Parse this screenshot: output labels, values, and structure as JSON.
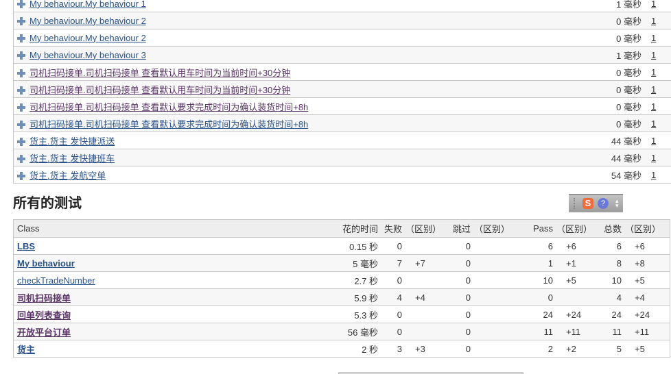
{
  "methods": [
    {
      "name": "My behaviour.My behaviour 1",
      "time": "1 毫秒",
      "count": "1",
      "visited": false
    },
    {
      "name": "My behaviour.My behaviour 2",
      "time": "0 毫秒",
      "count": "1",
      "visited": false
    },
    {
      "name": "My behaviour.My behaviour 2",
      "time": "0 毫秒",
      "count": "1",
      "visited": false
    },
    {
      "name": "My behaviour.My behaviour 3",
      "time": "1 毫秒",
      "count": "1",
      "visited": false
    },
    {
      "name": "司机扫码接单.司机扫码接单 查看默认用车时间为当前时间+30分钟",
      "time": "0 毫秒",
      "count": "1",
      "visited": true
    },
    {
      "name": "司机扫码接单.司机扫码接单 查看默认用车时间为当前时间+30分钟",
      "time": "0 毫秒",
      "count": "1",
      "visited": true
    },
    {
      "name": "司机扫码接单.司机扫码接单 查看默认要求完成时间为确认装货时间+8h",
      "time": "0 毫秒",
      "count": "1",
      "visited": true
    },
    {
      "name": "司机扫码接单.司机扫码接单 查看默认要求完成时间为确认装货时间+8h",
      "time": "0 毫秒",
      "count": "1",
      "visited": false
    },
    {
      "name": "货主.货主 发快捷派送",
      "time": "44 毫秒",
      "count": "1",
      "visited": false
    },
    {
      "name": "货主.货主 发快捷班车",
      "time": "44 毫秒",
      "count": "1",
      "visited": false
    },
    {
      "name": "货主.货主 发航空单",
      "time": "54 毫秒",
      "count": "1",
      "visited": false
    }
  ],
  "all_tests": {
    "title": "所有的测试",
    "headers": {
      "class": "Class",
      "time": "花的时间",
      "fail": "失败",
      "skip": "跳过",
      "pass": "Pass",
      "total": "总数",
      "diff": "（区别）"
    },
    "rows": [
      {
        "class": "LBS",
        "bold": true,
        "visited": false,
        "time": "0.15 秒",
        "fail": "0",
        "fail_diff": "",
        "skip": "0",
        "skip_diff": "",
        "pass": "6",
        "pass_diff": "+6",
        "total": "6",
        "total_diff": "+6"
      },
      {
        "class": "My behaviour",
        "bold": true,
        "visited": false,
        "time": "5 毫秒",
        "fail": "7",
        "fail_diff": "+7",
        "skip": "0",
        "skip_diff": "",
        "pass": "1",
        "pass_diff": "+1",
        "total": "8",
        "total_diff": "+8"
      },
      {
        "class": "checkTradeNumber",
        "bold": false,
        "visited": false,
        "time": "2.7 秒",
        "fail": "0",
        "fail_diff": "",
        "skip": "0",
        "skip_diff": "",
        "pass": "10",
        "pass_diff": "+5",
        "total": "10",
        "total_diff": "+5"
      },
      {
        "class": "司机扫码接单",
        "bold": true,
        "visited": true,
        "time": "5.9 秒",
        "fail": "4",
        "fail_diff": "+4",
        "skip": "0",
        "skip_diff": "",
        "pass": "0",
        "pass_diff": "",
        "total": "4",
        "total_diff": "+4"
      },
      {
        "class": "回单列表查询",
        "bold": true,
        "visited": true,
        "time": "5.3 秒",
        "fail": "0",
        "fail_diff": "",
        "skip": "0",
        "skip_diff": "",
        "pass": "24",
        "pass_diff": "+24",
        "total": "24",
        "total_diff": "+24"
      },
      {
        "class": "开放平台订单",
        "bold": true,
        "visited": true,
        "time": "56 毫秒",
        "fail": "0",
        "fail_diff": "",
        "skip": "0",
        "skip_diff": "",
        "pass": "11",
        "pass_diff": "+11",
        "total": "11",
        "total_diff": "+11"
      },
      {
        "class": "货主",
        "bold": true,
        "visited": false,
        "time": "2 秒",
        "fail": "3",
        "fail_diff": "+3",
        "skip": "0",
        "skip_diff": "",
        "pass": "2",
        "pass_diff": "+2",
        "total": "5",
        "total_diff": "+5"
      }
    ]
  },
  "ime_toolbar": {
    "logo": "S",
    "help": "?"
  }
}
